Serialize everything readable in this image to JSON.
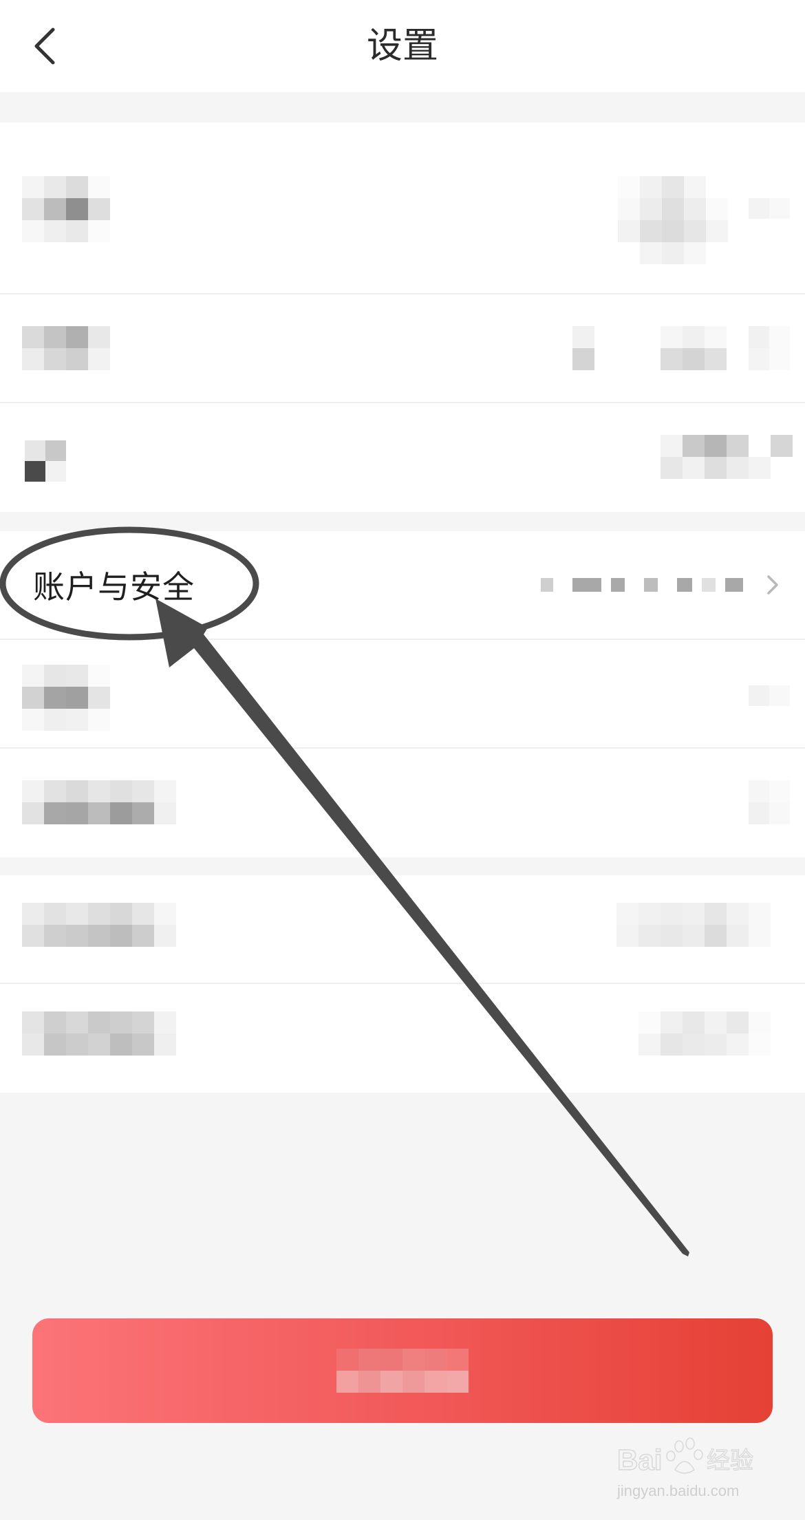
{
  "header": {
    "title": "设置",
    "back_icon": "chevron-left-icon"
  },
  "settings": {
    "account_security_label": "账户与安全"
  },
  "colors": {
    "accent_start": "#fb7478",
    "accent_end": "#e54135",
    "background": "#f5f5f5",
    "annotation": "#4a4a4a"
  },
  "watermark": {
    "brand": "Bai",
    "brand_suffix": "经验",
    "site": "jingyan.baidu.com"
  }
}
